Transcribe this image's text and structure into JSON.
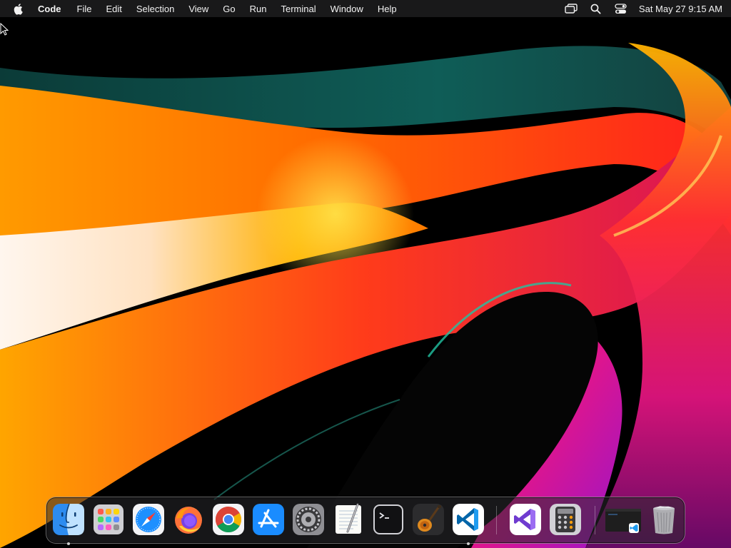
{
  "menubar": {
    "apple_icon": "apple-logo-icon",
    "app_name": "Code",
    "menus": [
      "File",
      "Edit",
      "Selection",
      "View",
      "Go",
      "Run",
      "Terminal",
      "Window",
      "Help"
    ],
    "status_icons": [
      "screen-mirroring-icon",
      "spotlight-search-icon",
      "control-center-icon"
    ],
    "clock": "Sat May 27  9:15 AM"
  },
  "dock": {
    "apps": [
      {
        "name": "Finder",
        "icon": "finder-icon",
        "running": true
      },
      {
        "name": "Launchpad",
        "icon": "launchpad-icon",
        "running": false
      },
      {
        "name": "Safari",
        "icon": "safari-icon",
        "running": false
      },
      {
        "name": "Firefox",
        "icon": "firefox-icon",
        "running": false
      },
      {
        "name": "Google Chrome",
        "icon": "chrome-icon",
        "running": false
      },
      {
        "name": "App Store",
        "icon": "app-store-icon",
        "running": false
      },
      {
        "name": "System Preferences",
        "icon": "system-preferences-icon",
        "running": false
      },
      {
        "name": "TextEdit",
        "icon": "textedit-icon",
        "running": false
      },
      {
        "name": "Terminal",
        "icon": "terminal-icon",
        "running": false
      },
      {
        "name": "GarageBand",
        "icon": "garageband-icon",
        "running": false
      },
      {
        "name": "Visual Studio Code",
        "icon": "vscode-icon",
        "running": true
      }
    ],
    "recent": [
      {
        "name": "Visual Studio",
        "icon": "visual-studio-icon"
      },
      {
        "name": "Calculator",
        "icon": "calculator-icon"
      }
    ],
    "other": [
      {
        "name": "Minimized Window",
        "icon": "minimized-window-icon"
      },
      {
        "name": "Trash",
        "icon": "trash-icon"
      }
    ]
  },
  "colors": {
    "menubar_bg": "#1c1c1e",
    "wallpaper_orange": "#ff8a00",
    "wallpaper_red": "#ff1a1a",
    "wallpaper_teal": "#0f5d57",
    "wallpaper_magenta": "#d6148a"
  }
}
